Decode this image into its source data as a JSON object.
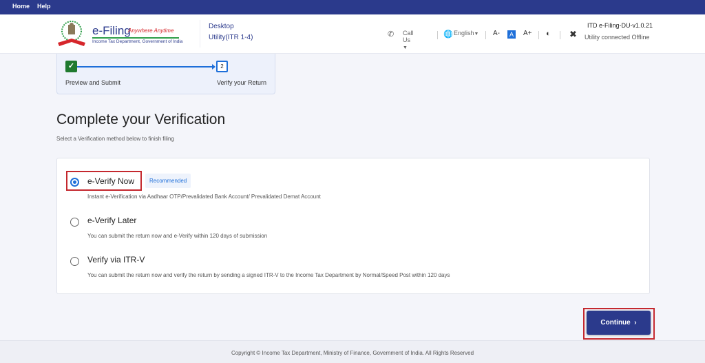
{
  "topbar": {
    "home": "Home",
    "help": "Help"
  },
  "header": {
    "logo_title": "e-Filing",
    "logo_tagline": "Anywhere Anytime",
    "logo_subtitle": "Income Tax Department, Government of India",
    "app_name_line1": "Desktop",
    "app_name_line2": "Utility(ITR 1-4)",
    "call_us": "Call Us",
    "language": "English",
    "font_decrease": "A-",
    "font_normal": "A",
    "font_increase": "A+",
    "version": "ITD e-Filing-DU-v1.0.21",
    "connection_status": "Utility connected Offline"
  },
  "stepper": {
    "steps": [
      {
        "number": "1",
        "label": "Preview and Submit",
        "status": "completed"
      },
      {
        "number": "2",
        "label": "Verify your Return",
        "status": "current"
      }
    ]
  },
  "main": {
    "title": "Complete your Verification",
    "subtitle": "Select a Verification method below to finish filing",
    "options": [
      {
        "title": "e-Verify Now",
        "badge": "Recommended",
        "description": "Instant e-Verification via Aadhaar OTP/Prevalidated Bank Account/ Prevalidated Demat Account",
        "selected": true
      },
      {
        "title": "e-Verify Later",
        "description": "You can submit the return now and e-Verify within 120 days of submission",
        "selected": false
      },
      {
        "title": "Verify via ITR-V",
        "description": "You can submit the return now and verify the return by sending a signed ITR-V to the Income Tax Department by Normal/Speed Post within 120 days",
        "selected": false
      }
    ],
    "continue_label": "Continue"
  },
  "footer": {
    "copyright": "Copyright © Income Tax Department, Ministry of Finance, Government of India. All Rights Reserved"
  },
  "colors": {
    "primary": "#2b3a8c",
    "accent": "#1e6fd9",
    "success": "#1f7a2f",
    "highlight": "#c4282e"
  }
}
